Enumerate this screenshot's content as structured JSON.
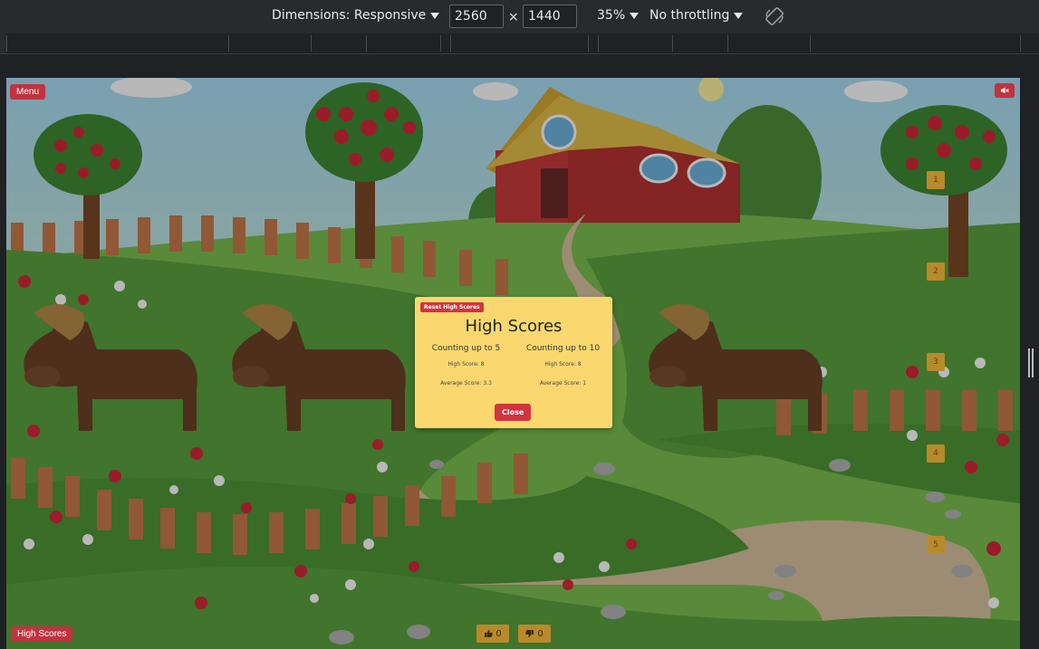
{
  "devtools": {
    "dimensions_label": "Dimensions: Responsive",
    "width": "2560",
    "times": "×",
    "height": "1440",
    "zoom": "35%",
    "throttling": "No throttling"
  },
  "game": {
    "menu_label": "Menu",
    "high_scores_label": "High Scores",
    "number_tiles": [
      "1",
      "2",
      "3",
      "4",
      "5"
    ],
    "thumbs_up_count": "0",
    "thumbs_down_count": "0",
    "icons": {
      "mute": "speaker-mute-icon",
      "thumbs_up": "thumbs-up-icon",
      "thumbs_down": "thumbs-down-icon"
    }
  },
  "modal": {
    "reset_label": "Reset High Scores",
    "title": "High Scores",
    "columns": [
      {
        "heading": "Counting up to 5",
        "high_score": "High Score: 8",
        "average": "Average Score: 3.3"
      },
      {
        "heading": "Counting up to 10",
        "high_score": "High Score: 8",
        "average": "Average Score: 1"
      }
    ],
    "close_label": "Close"
  },
  "colors": {
    "button_red": "#c0333f",
    "modal_bg": "#fbd86f",
    "tile": "#b98a2a"
  }
}
